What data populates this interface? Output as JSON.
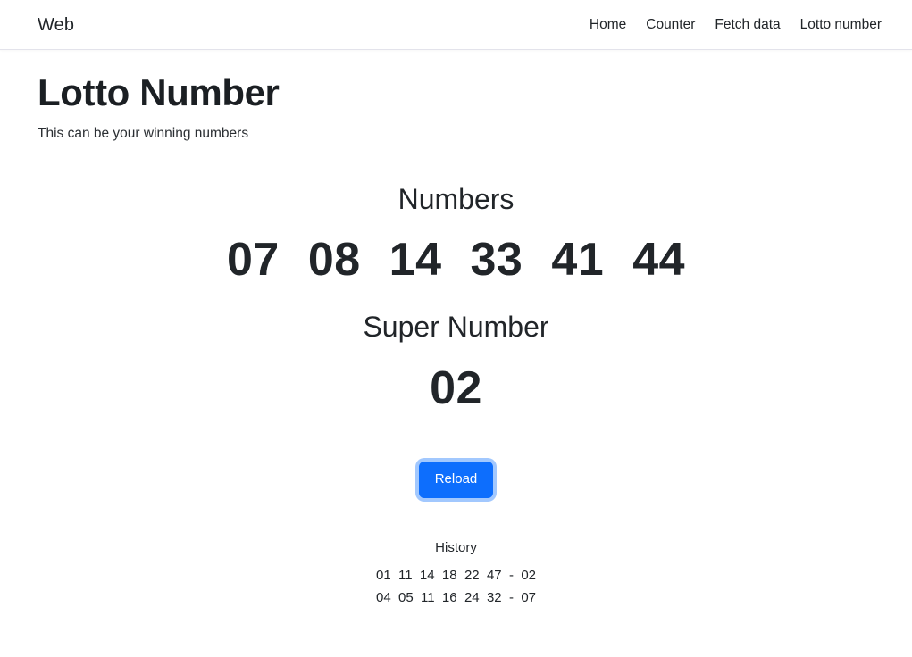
{
  "header": {
    "brand": "Web",
    "nav": [
      {
        "label": "Home"
      },
      {
        "label": "Counter"
      },
      {
        "label": "Fetch data"
      },
      {
        "label": "Lotto number"
      }
    ]
  },
  "page": {
    "title": "Lotto Number",
    "subtitle": "This can be your winning numbers"
  },
  "lotto": {
    "numbers_label": "Numbers",
    "numbers": [
      "07",
      "08",
      "14",
      "33",
      "41",
      "44"
    ],
    "super_label": "Super Number",
    "super_number": "02",
    "reload_label": "Reload"
  },
  "history": {
    "title": "History",
    "rows": [
      "01  11  14  18  22  47  -  02",
      "04  05  11  16  24  32  -  07"
    ]
  },
  "colors": {
    "primary": "#0d6efd",
    "text": "#212529",
    "border": "#e3e3eb",
    "background": "#ffffff"
  }
}
